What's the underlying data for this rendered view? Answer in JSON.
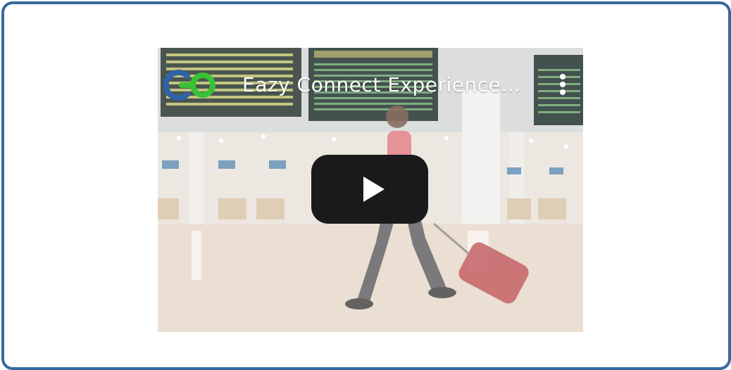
{
  "video": {
    "title": "Eazy Connect Experience...",
    "logo_text": "CO",
    "play_icon": "play-icon",
    "menu_icon": "more-vertical-icon"
  },
  "colors": {
    "frame_border": "#356a9d",
    "logo_blue": "#2f63a8",
    "logo_green": "#38c234",
    "play_button": "#1a1a1a"
  }
}
